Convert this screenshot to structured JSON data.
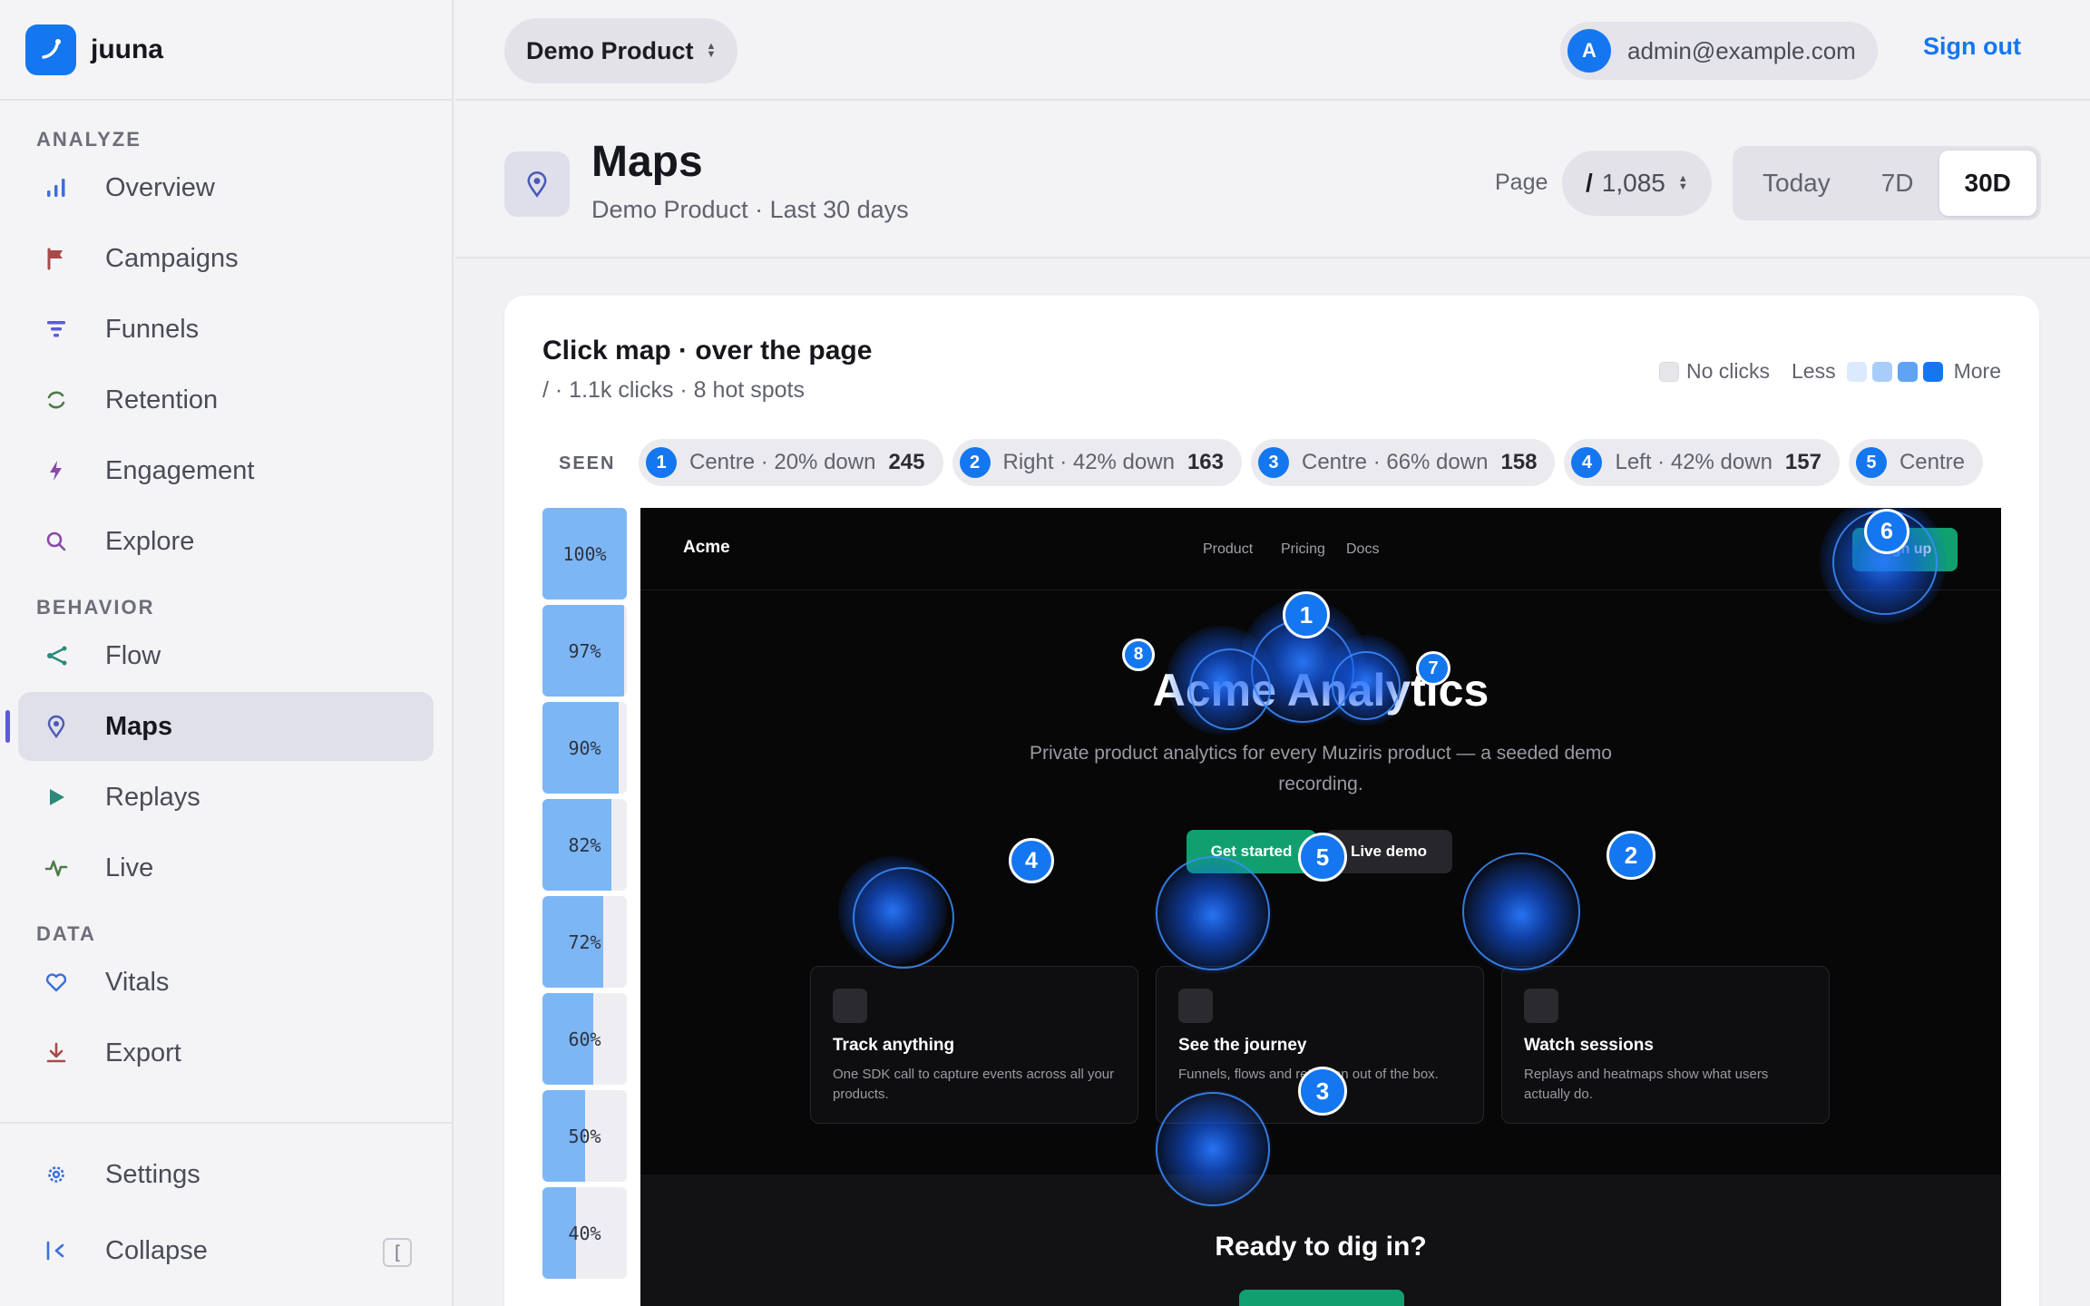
{
  "app": {
    "name": "juuna"
  },
  "nav": {
    "sections": {
      "analyze": "ANALYZE",
      "behavior": "BEHAVIOR",
      "data": "DATA"
    },
    "overview": "Overview",
    "campaigns": "Campaigns",
    "funnels": "Funnels",
    "retention": "Retention",
    "engagement": "Engagement",
    "explore": "Explore",
    "flow": "Flow",
    "maps": "Maps",
    "replays": "Replays",
    "live": "Live",
    "vitals": "Vitals",
    "export": "Export",
    "settings": "Settings",
    "collapse": "Collapse",
    "collapse_shortcut": "[",
    "active": "maps"
  },
  "topbar": {
    "product": "Demo Product",
    "user_initial": "A",
    "user_email": "admin@example.com",
    "sign_out": "Sign out"
  },
  "header": {
    "title": "Maps",
    "subtitle": "Demo Product · Last 30 days",
    "page_label": "Page",
    "page_path": "/",
    "page_count": "1,085",
    "ranges": [
      "Today",
      "7D",
      "30D"
    ],
    "selected_range": "30D"
  },
  "card": {
    "title": "Click map · over the page",
    "subtitle": "/ · 1.1k clicks · 8 hot spots",
    "legend": {
      "none": "No clicks",
      "less": "Less",
      "more": "More"
    },
    "legend_colors": [
      "#dbeafe",
      "#a9cdfb",
      "#5fa2f6",
      "#1477f0"
    ],
    "seen_label": "SEEN"
  },
  "hotspots": [
    {
      "n": "1",
      "label": "Centre · 20% down",
      "count": "245"
    },
    {
      "n": "2",
      "label": "Right · 42% down",
      "count": "163"
    },
    {
      "n": "3",
      "label": "Centre · 66% down",
      "count": "158"
    },
    {
      "n": "4",
      "label": "Left · 42% down",
      "count": "157"
    },
    {
      "n": "5",
      "label": "Centre",
      "count": ""
    }
  ],
  "scroll_depth": [
    {
      "label": "100%",
      "value": 100
    },
    {
      "label": "97%",
      "value": 97
    },
    {
      "label": "90%",
      "value": 90
    },
    {
      "label": "82%",
      "value": 82
    },
    {
      "label": "72%",
      "value": 72
    },
    {
      "label": "60%",
      "value": 60
    },
    {
      "label": "50%",
      "value": 50
    },
    {
      "label": "40%",
      "value": 40
    }
  ],
  "preview": {
    "brand": "Acme",
    "links": [
      "Product",
      "Pricing",
      "Docs"
    ],
    "signup": "Sign up",
    "headline": "Acme Analytics",
    "lede": "Private product analytics for every Muziris product — a seeded demo recording.",
    "cta_primary": "Get started",
    "cta_secondary": "Live demo",
    "features": [
      {
        "title": "Track anything",
        "desc": "One SDK call to capture events across all your products."
      },
      {
        "title": "See the journey",
        "desc": "Funnels, flows and retention out of the box."
      },
      {
        "title": "Watch sessions",
        "desc": "Replays and heatmaps show what users actually do."
      }
    ],
    "footer_headline": "Ready to dig in?"
  },
  "colors": {
    "accent": "#1477f0",
    "nav_active_bar": "#5a5bd6",
    "preview_green": "#10a070"
  }
}
